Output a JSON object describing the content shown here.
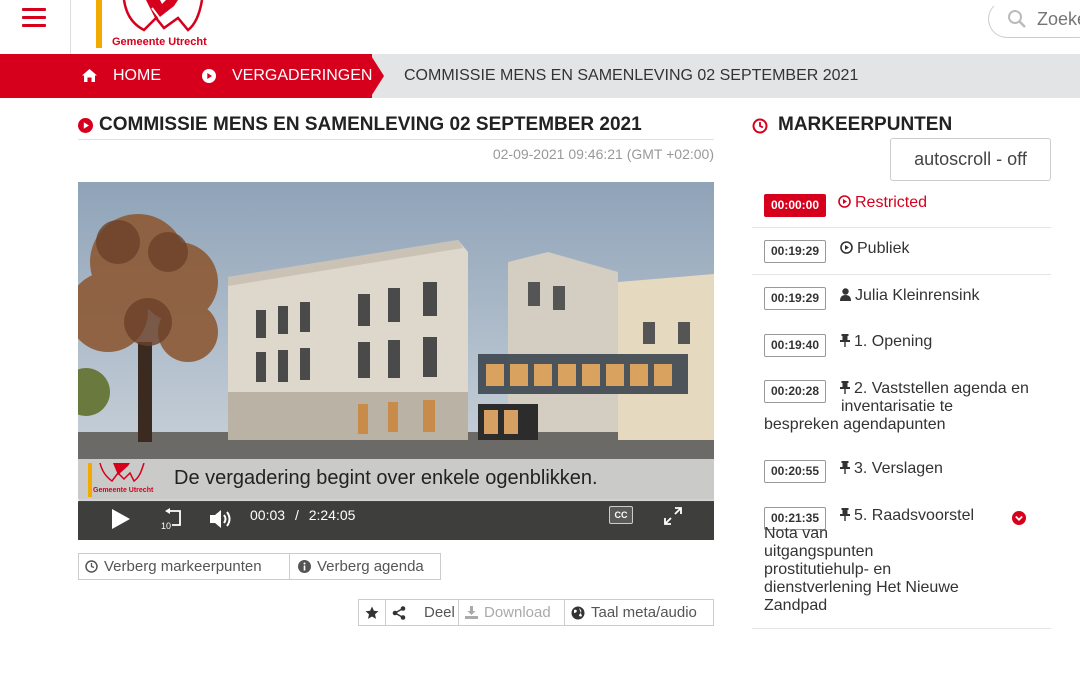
{
  "header": {
    "logo_text": "Gemeente Utrecht",
    "search_placeholder": "Zoeken",
    "brand_color": "#d6001c",
    "accent_color": "#f2a900"
  },
  "breadcrumb": {
    "home": "HOME",
    "meetings": "VERGADERINGEN",
    "current": "COMMISSIE MENS EN SAMENLEVING 02 SEPTEMBER 2021"
  },
  "main": {
    "title": "COMMISSIE MENS EN SAMENLEVING 02 SEPTEMBER 2021",
    "datetime": "02-09-2021 09:46:21 (GMT +02:00)"
  },
  "video": {
    "subtitle": "De vergadering begint over enkele ogenblikken.",
    "subtitle_logo_text": "Gemeente Utrecht",
    "current_time": "00:03",
    "separator": "/",
    "duration": "2:24:05",
    "skip_back_label": "10",
    "cc_label": "CC"
  },
  "buttons": {
    "hide_markers": "Verberg markeerpunten",
    "hide_agenda": "Verberg agenda",
    "share": "Deel",
    "download": "Download",
    "language": "Taal meta/audio"
  },
  "markers_panel": {
    "title": "MARKEERPUNTEN",
    "autoscroll": "autoscroll - off",
    "items": [
      {
        "time": "00:00:00",
        "label": "Restricted",
        "icon": "play-circle-icon",
        "active": true
      },
      {
        "time": "00:19:29",
        "label": "Publiek",
        "icon": "play-circle-icon",
        "active": false
      },
      {
        "time": "00:19:29",
        "label": "Julia Kleinrensink",
        "icon": "user-icon",
        "active": false
      },
      {
        "time": "00:19:40",
        "label": "1. Opening",
        "icon": "pin-icon",
        "active": false
      },
      {
        "time": "00:20:28",
        "label_line1": "2. Vaststellen agenda en",
        "label_line2": "inventarisatie te",
        "label_line3": "bespreken agendapunten",
        "icon": "pin-icon",
        "active": false
      },
      {
        "time": "00:20:55",
        "label": "3. Verslagen",
        "icon": "pin-icon",
        "active": false
      },
      {
        "time": "00:21:35",
        "label_line1": "5. Raadsvoorstel",
        "label_line2": "Nota van",
        "label_line3": "uitgangspunten",
        "label_line4": "prostitutiehulp- en",
        "label_line5": "dienstverlening Het Nieuwe",
        "label_line6": "Zandpad",
        "icon": "pin-icon",
        "active": false,
        "expandable": true
      }
    ]
  }
}
